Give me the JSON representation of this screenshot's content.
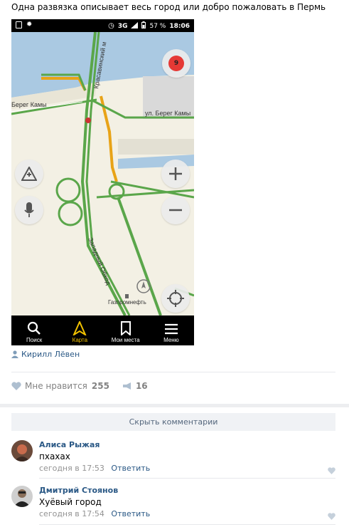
{
  "post": {
    "title": "Одна развязка описывает весь город или добро пожаловать в Пермь",
    "author": "Кирилл Лёвен"
  },
  "phone": {
    "status_bar": {
      "network": "3G",
      "battery": "57 %",
      "time": "18:06"
    },
    "map": {
      "street_labels": [
        "Красавинский м",
        "Берег Камы",
        "ул. Берег Камы",
        "Западный Обход"
      ],
      "poi_label": "Газпромнефть",
      "traffic_badge": "9"
    },
    "nav": [
      {
        "label": "Поиск",
        "icon": "search-icon"
      },
      {
        "label": "Карта",
        "icon": "navigator-arrow-icon"
      },
      {
        "label": "Мои места",
        "icon": "bookmark-icon"
      },
      {
        "label": "Меню",
        "icon": "menu-icon"
      }
    ]
  },
  "reactions": {
    "likes_label": "Мне нравится",
    "likes_count": "255",
    "reposts_count": "16"
  },
  "comments": {
    "hide_label": "Скрыть комментарии",
    "items": [
      {
        "author": "Алиса Рыжая",
        "text": "пхахах",
        "time": "сегодня в 17:53",
        "reply": "Ответить"
      },
      {
        "author": "Дмитрий Стоянов",
        "text": "Хуёвый город",
        "time": "сегодня в 17:54",
        "reply": "Ответить"
      }
    ]
  }
}
